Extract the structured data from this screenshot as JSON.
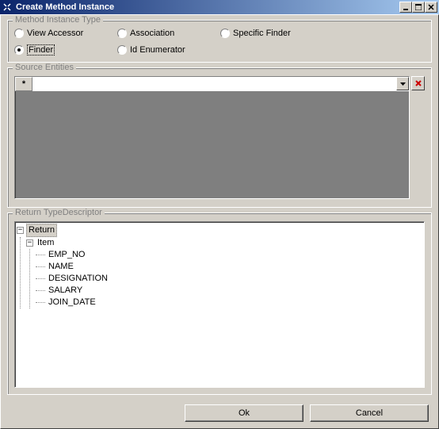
{
  "window": {
    "title": "Create Method Instance"
  },
  "method_instance_type": {
    "legend": "Method Instance Type",
    "options": {
      "view_accessor": "View Accessor",
      "association": "Association",
      "specific_finder": "Specific Finder",
      "finder": "Finder",
      "id_enumerator": "Id Enumerator"
    },
    "selected": "finder"
  },
  "source_entities": {
    "legend": "Source Entities",
    "new_row_marker": "*"
  },
  "return_type_descriptor": {
    "legend": "Return TypeDescriptor",
    "tree": {
      "root": "Return",
      "item": "Item",
      "fields": [
        "EMP_NO",
        "NAME",
        "DESIGNATION",
        "SALARY",
        "JOIN_DATE"
      ]
    }
  },
  "buttons": {
    "ok": "Ok",
    "cancel": "Cancel"
  }
}
